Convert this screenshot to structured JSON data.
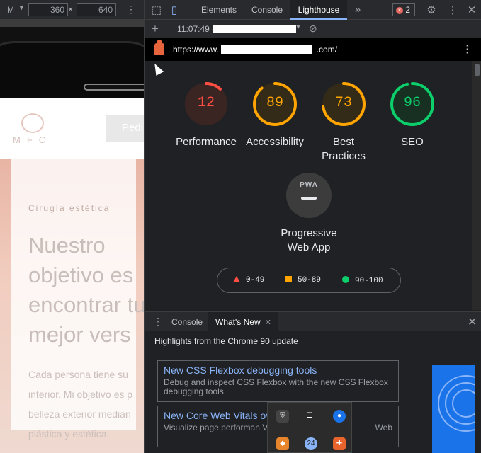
{
  "device_toolbar": {
    "device": "M",
    "width": "360",
    "times": "×",
    "height": "640"
  },
  "website": {
    "logo_text": "MFC",
    "button_label": "Pedi",
    "eyebrow": "Cirugía estética",
    "heading": "Nuestro objetivo es encontrar tu mejor vers",
    "body": "Cada persona tiene su interior. Mi objetivo es p belleza exterior median plástica y estética."
  },
  "devtools": {
    "tabs": [
      "Elements",
      "Console",
      "Lighthouse"
    ],
    "active_tab": "Lighthouse",
    "error_count": "2",
    "lighthouse_toolbar": {
      "time": "11:07:49 -"
    },
    "url_prefix": "https://www.",
    "url_suffix": ".com/",
    "scores": [
      {
        "label": "Performance",
        "value": 12,
        "color": "#ff4e42",
        "bg": "#3b2523"
      },
      {
        "label": "Accessibility",
        "value": 89,
        "color": "#ffa400",
        "bg": "#332a18"
      },
      {
        "label": "Best Practices",
        "value": 73,
        "color": "#ffa400",
        "bg": "#332a18"
      },
      {
        "label": "SEO",
        "value": 96,
        "color": "#0cce6b",
        "bg": "#173022"
      }
    ],
    "pwa": {
      "badge": "PWA",
      "label": "Progressive Web App"
    },
    "legend": [
      {
        "range": "0-49",
        "color": "#ff4e42",
        "shape": "triangle"
      },
      {
        "range": "50-89",
        "color": "#ffa400",
        "shape": "square"
      },
      {
        "range": "90-100",
        "color": "#0cce6b",
        "shape": "circle"
      }
    ],
    "drawer": {
      "tabs": [
        "Console",
        "What's New"
      ],
      "active_tab": "What's New",
      "highlights_title": "Highlights from the Chrome 90 update",
      "cards": [
        {
          "title": "New CSS Flexbox debugging tools",
          "desc": "Debug and inspect CSS Flexbox with the new CSS Flexbox debugging tools."
        },
        {
          "title": "New Core Web Vitals ov",
          "desc": "Visualize page performan Vitals overlay.",
          "desc_end": "Web"
        }
      ]
    }
  },
  "tray_icons": [
    "shield-icon",
    "screen-icon",
    "chrome-icon",
    "app-icon",
    "clock-24-icon",
    "puzzle-icon"
  ]
}
